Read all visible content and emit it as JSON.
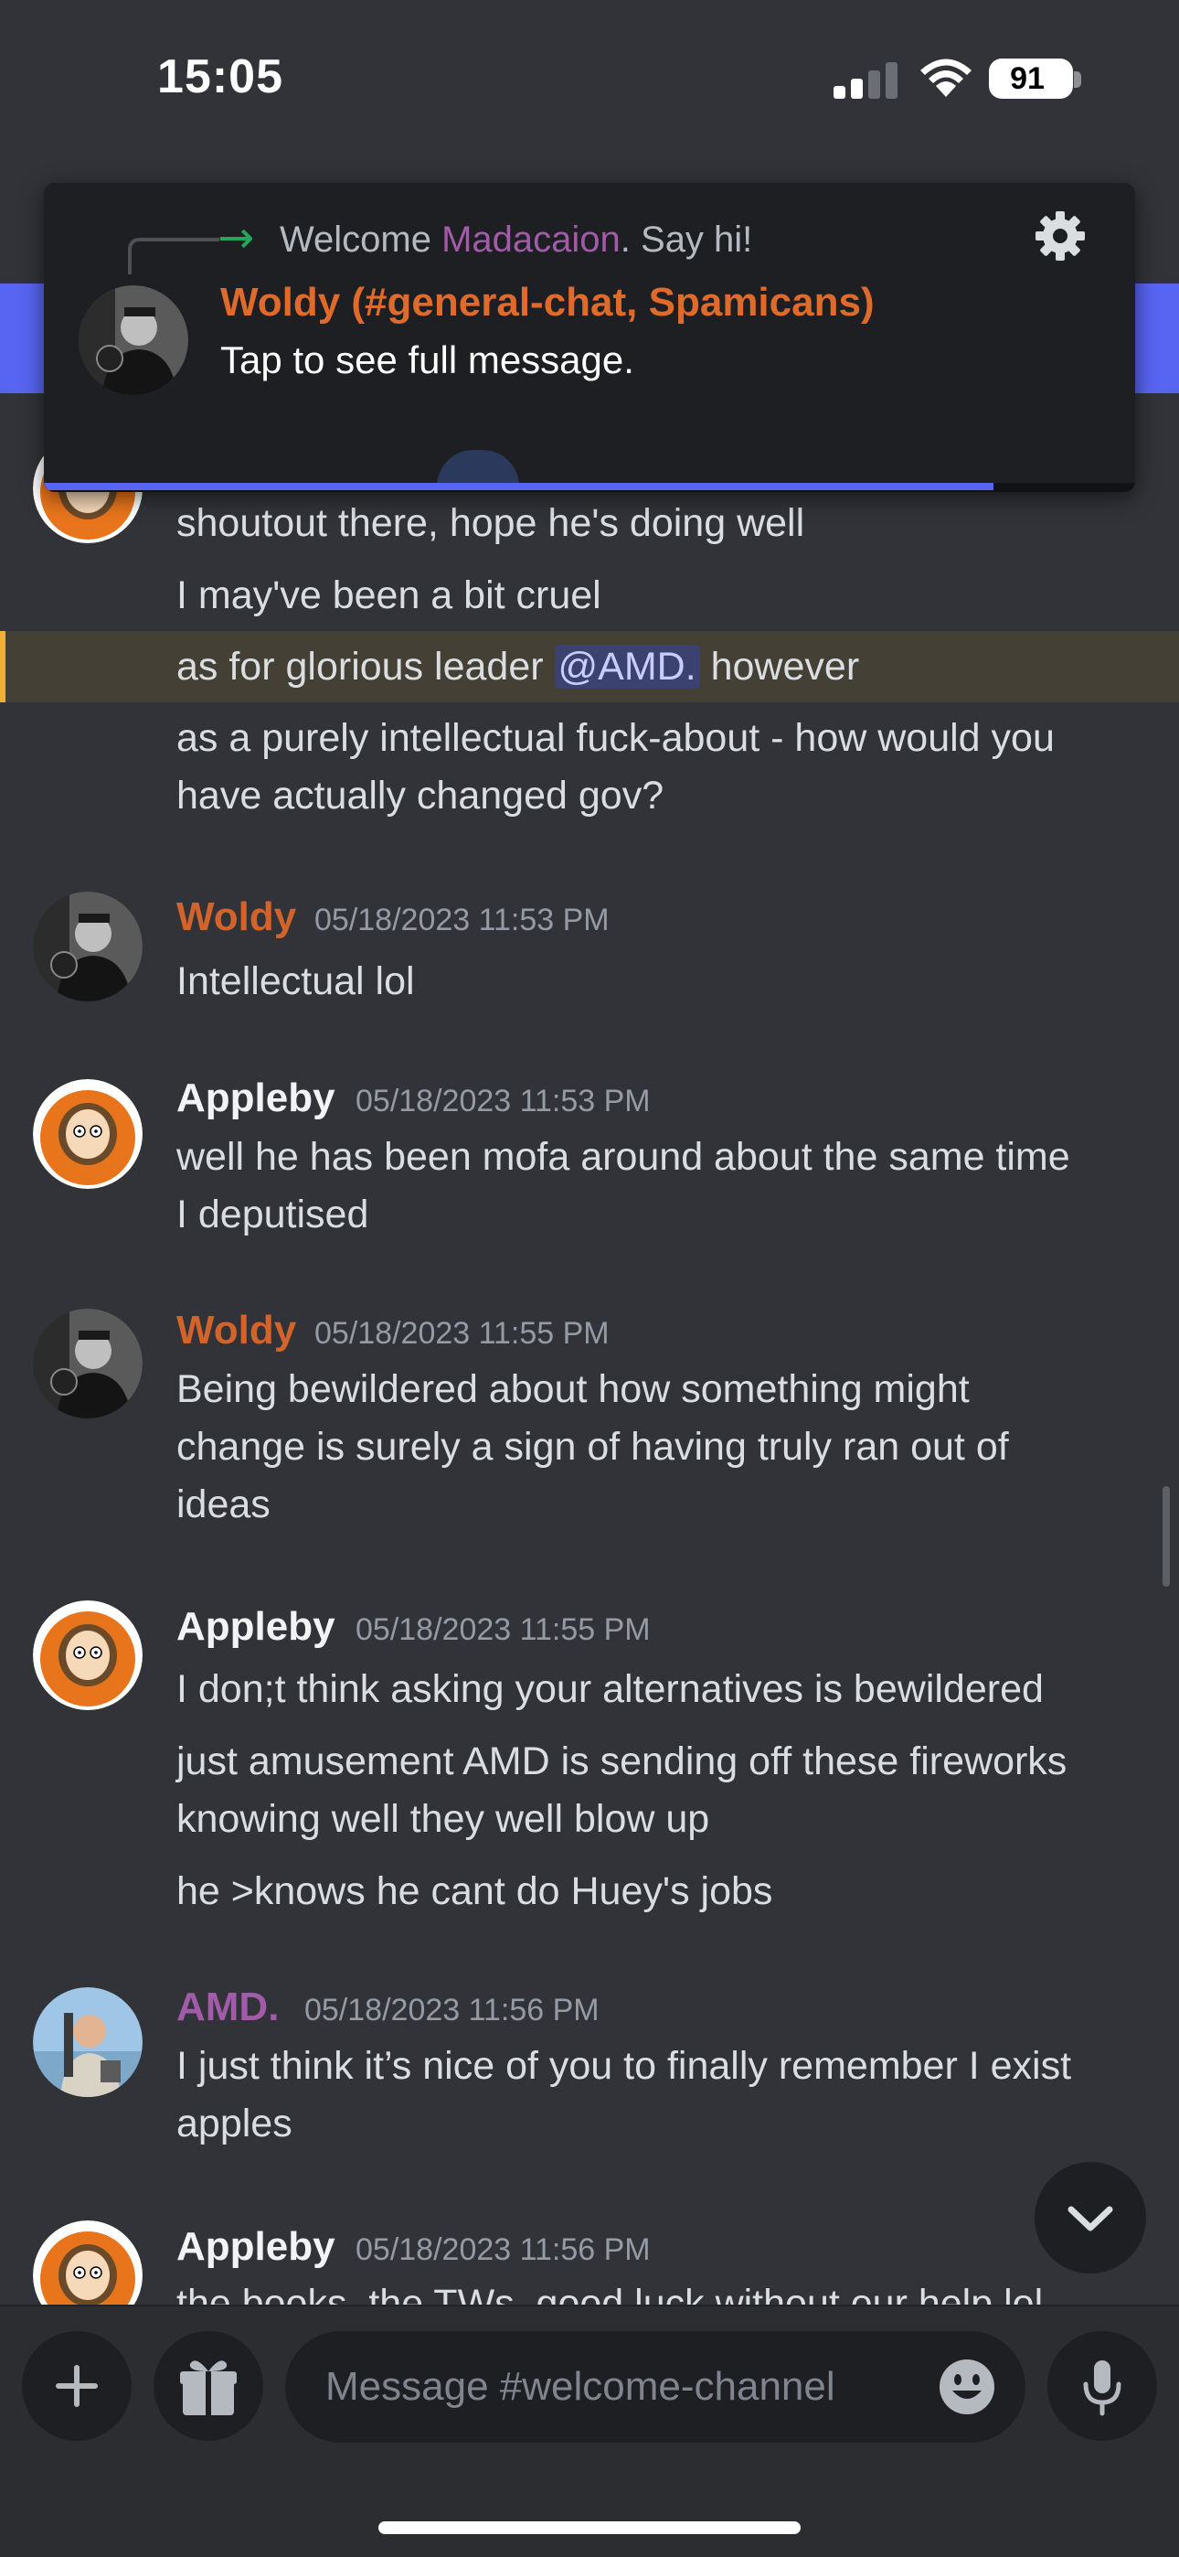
{
  "status_bar": {
    "time": "15:05",
    "battery": "91"
  },
  "notification": {
    "reply_prefix": "Welcome ",
    "reply_user": "Madacaion",
    "reply_suffix": ". Say hi!",
    "title": "Woldy (#general-chat, Spamicans)",
    "body": "Tap to see full message.",
    "progress": 0.87
  },
  "messages": {
    "m1_line1": "shoutout there, hope he's doing well",
    "m1_line2": "I may've been a bit cruel",
    "m1_line3_pre": "as for glorious leader ",
    "m1_line3_mention": "@AMD.",
    "m1_line3_post": " however",
    "m1_line4": "as a purely intellectual fuck-about - how would you",
    "m1_line5": "have actually changed gov?",
    "m2_author": "Woldy",
    "m2_time": "05/18/2023 11:53 PM",
    "m2_line1": "Intellectual lol",
    "m3_author": "Appleby",
    "m3_time": "05/18/2023 11:53 PM",
    "m3_line1": "well he has been mofa around about the same time",
    "m3_line2": "I deputised",
    "m4_author": "Woldy",
    "m4_time": "05/18/2023 11:55 PM",
    "m4_line1": "Being bewildered about how something might",
    "m4_line2": "change is surely a sign of having truly ran out of",
    "m4_line3": "ideas",
    "m5_author": "Appleby",
    "m5_time": "05/18/2023 11:55 PM",
    "m5_line1": "I don;t think asking your alternatives is bewildered",
    "m5_line2": "just amusement AMD is sending off these fireworks",
    "m5_line3": "knowing well they well blow up",
    "m5_line4": "he >knows he cant do Huey's jobs",
    "m6_author": "AMD.",
    "m6_time": "05/18/2023 11:56 PM",
    "m6_line1": "I just think it’s nice of you to finally remember I exist",
    "m6_line2": "apples",
    "m7_author": "Appleby",
    "m7_time": "05/18/2023 11:56 PM",
    "m7_line1": "the books, the TWs, good luck without our help lol"
  },
  "composer": {
    "placeholder": "Message #welcome-channel"
  },
  "colors": {
    "background": "#313338",
    "accent": "#5865f2",
    "woldy": "#d2632a",
    "amd": "#a15ba8",
    "mention_highlight": "#444036"
  },
  "icons": [
    "gear-icon",
    "arrow-right-icon",
    "plus-icon",
    "gift-icon",
    "emoji-icon",
    "microphone-icon",
    "chevron-down-icon"
  ]
}
